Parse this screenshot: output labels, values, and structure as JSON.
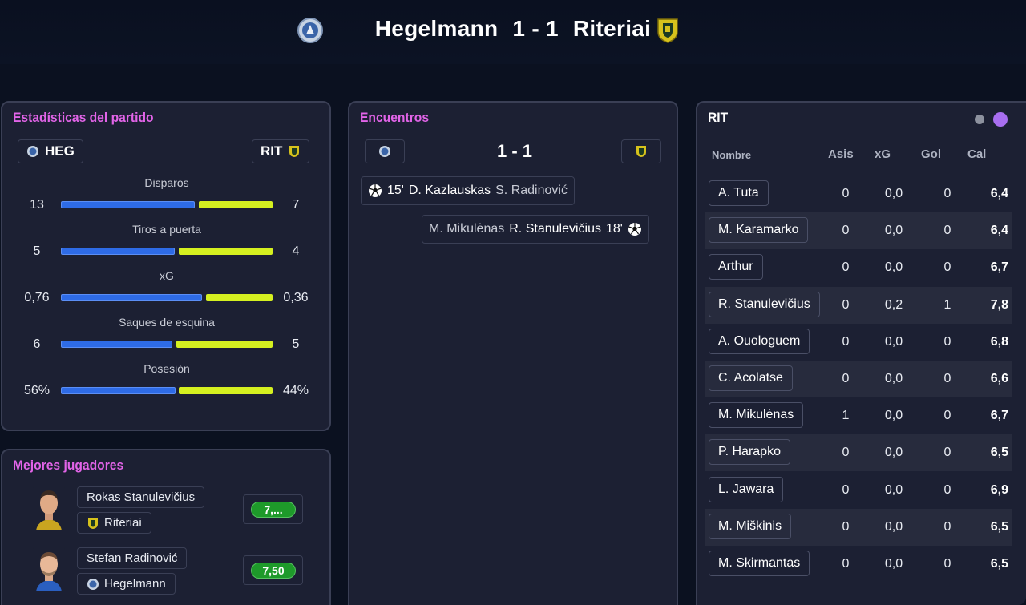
{
  "match": {
    "home": "Hegelmann",
    "score": "1 - 1",
    "away": "Riteriai"
  },
  "stats": {
    "title": "Estadísticas del partido",
    "home_abbr": "HEG",
    "away_abbr": "RIT",
    "rows": [
      {
        "label": "Disparos",
        "home": "13",
        "away": "7"
      },
      {
        "label": "Tiros a puerta",
        "home": "5",
        "away": "4"
      },
      {
        "label": "xG",
        "home": "0,76",
        "away": "0,36"
      },
      {
        "label": "Saques de esquina",
        "home": "6",
        "away": "5"
      },
      {
        "label": "Posesión",
        "home": "56%",
        "away": "44%"
      }
    ]
  },
  "best": {
    "title": "Mejores jugadores",
    "players": [
      {
        "name": "Rokas Stanulevičius",
        "team": "Riteriai",
        "rating": "7,..."
      },
      {
        "name": "Stefan Radinović",
        "team": "Hegelmann",
        "rating": "7,50"
      }
    ]
  },
  "encounters": {
    "title": "Encuentros",
    "score": "1 - 1",
    "events": [
      {
        "minute": "15'",
        "scorer": "D. Kazlauskas",
        "assist": "S. Radinović"
      },
      {
        "minute": "18'",
        "scorer": "R. Stanulevičius",
        "assist": "M. Mikulėnas"
      }
    ]
  },
  "lineup": {
    "team": "RIT",
    "headers": {
      "name": "Nombre",
      "assists": "Asis",
      "xg": "xG",
      "goals": "Gol",
      "rating": "Cal"
    },
    "players": [
      {
        "name": "A. Tuta",
        "assists": "0",
        "xg": "0,0",
        "goals": "0",
        "rating": "6,4"
      },
      {
        "name": "M. Karamarko",
        "assists": "0",
        "xg": "0,0",
        "goals": "0",
        "rating": "6,4"
      },
      {
        "name": "Arthur",
        "assists": "0",
        "xg": "0,0",
        "goals": "0",
        "rating": "6,7"
      },
      {
        "name": "R. Stanulevičius",
        "assists": "0",
        "xg": "0,2",
        "goals": "1",
        "rating": "7,8"
      },
      {
        "name": "A. Ouologuem",
        "assists": "0",
        "xg": "0,0",
        "goals": "0",
        "rating": "6,8"
      },
      {
        "name": "C. Acolatse",
        "assists": "0",
        "xg": "0,0",
        "goals": "0",
        "rating": "6,6"
      },
      {
        "name": "M. Mikulėnas",
        "assists": "1",
        "xg": "0,0",
        "goals": "0",
        "rating": "6,7"
      },
      {
        "name": "P. Harapko",
        "assists": "0",
        "xg": "0,0",
        "goals": "0",
        "rating": "6,5"
      },
      {
        "name": "L. Jawara",
        "assists": "0",
        "xg": "0,0",
        "goals": "0",
        "rating": "6,9"
      },
      {
        "name": "M. Miškinis",
        "assists": "0",
        "xg": "0,0",
        "goals": "0",
        "rating": "6,5"
      },
      {
        "name": "M. Skirmantas",
        "assists": "0",
        "xg": "0,0",
        "goals": "0",
        "rating": "6,5"
      }
    ]
  },
  "colors": {
    "home_bar": "#2e6be6",
    "away_bar": "#d5f020",
    "accent_title": "#e264e8",
    "rating_good": "#1e9a2a",
    "page_active_dot": "#a86ef0"
  }
}
